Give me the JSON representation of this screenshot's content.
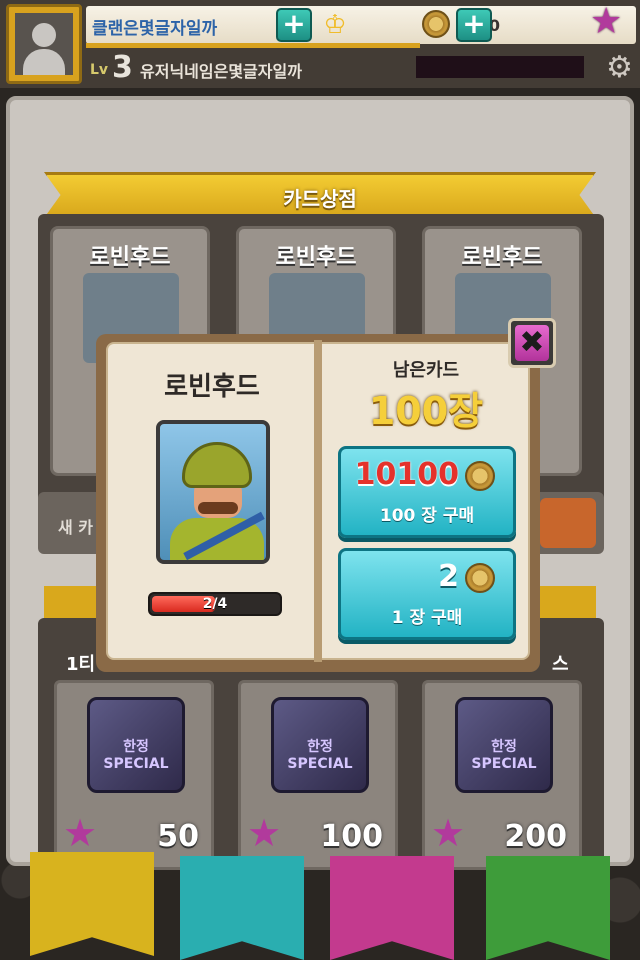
{
  "header": {
    "clan_name": "클랜은몇글자일까",
    "gold": "2820",
    "level_prefix": "Lv",
    "level": "3",
    "nickname": "유저닉네임은몇글자일까",
    "icons": [
      "avatar-icon",
      "crown-icon",
      "plus-icon",
      "coin-icon",
      "plus-icon",
      "star-icon",
      "gear-icon"
    ]
  },
  "shop": {
    "title": "카드상점",
    "cards": [
      {
        "name": "로빈후드"
      },
      {
        "name": "로빈후드"
      },
      {
        "name": "로빈후드"
      }
    ],
    "strip_text": "새 카",
    "chest_titles": [
      "1티",
      "스"
    ],
    "chests": [
      {
        "label": "한정 SPECIAL",
        "price": "50"
      },
      {
        "label": "한정 SPECIAL",
        "price": "100"
      },
      {
        "label": "한정 SPECIAL",
        "price": "200"
      }
    ]
  },
  "modal": {
    "card_name": "로빈후드",
    "progress_text": "2/4",
    "progress_fraction": 0.5,
    "remaining_label": "남은카드",
    "remaining_count": "100장",
    "buy_all": {
      "price": "10100",
      "label": "100 장 구매"
    },
    "buy_one": {
      "price": "2",
      "label": "1 장 구매"
    },
    "close_symbol": "✖"
  },
  "tabs": [
    {
      "color": "#d8b31e"
    },
    {
      "color": "#2aaeb0"
    },
    {
      "color": "#c33a8e"
    },
    {
      "color": "#3e9c3a"
    }
  ]
}
